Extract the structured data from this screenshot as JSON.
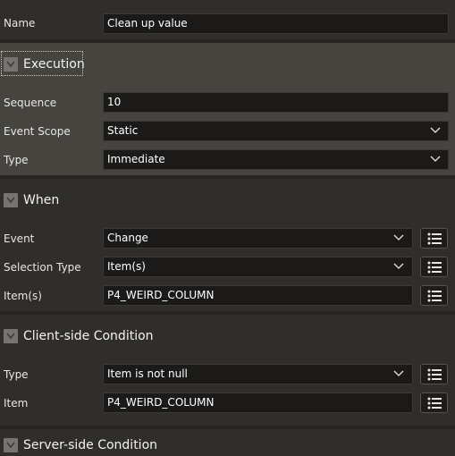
{
  "name_row": {
    "label": "Name",
    "value": "Clean up value"
  },
  "execution": {
    "title": "Execution",
    "sequence_label": "Sequence",
    "sequence_value": "10",
    "event_scope_label": "Event Scope",
    "event_scope_value": "Static",
    "type_label": "Type",
    "type_value": "Immediate"
  },
  "when": {
    "title": "When",
    "event_label": "Event",
    "event_value": "Change",
    "selection_type_label": "Selection Type",
    "selection_type_value": "Item(s)",
    "items_label": "Item(s)",
    "items_value": "P4_WEIRD_COLUMN"
  },
  "client_condition": {
    "title": "Client-side Condition",
    "type_label": "Type",
    "type_value": "Item is not null",
    "item_label": "Item",
    "item_value": "P4_WEIRD_COLUMN"
  },
  "server_condition": {
    "title": "Server-side Condition"
  },
  "colors": {
    "background": "#302e2c",
    "active_section": "#45443f",
    "field_background": "#1b1a19",
    "collapse_icon": "#77746f"
  },
  "icons": {
    "collapse": "chevron-down-icon",
    "select": "chevron-down-icon",
    "list_button": "list-icon"
  }
}
